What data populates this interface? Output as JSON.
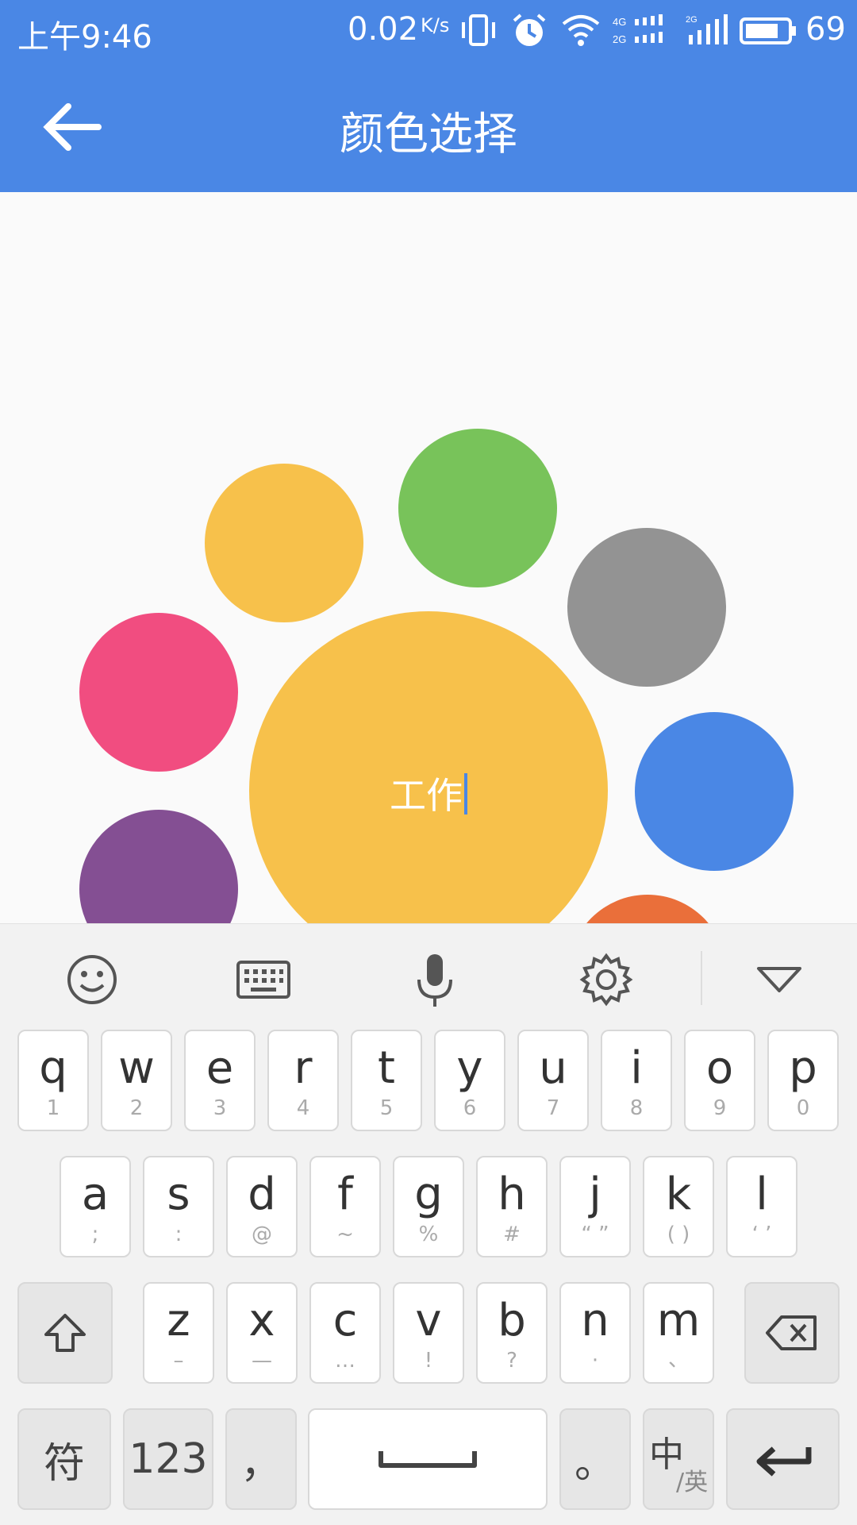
{
  "status_bar": {
    "time": "上午9:46",
    "net_speed": "0.02",
    "net_speed_unit": "K/s",
    "battery_percent": "69",
    "icons": [
      "vibrate-icon",
      "alarm-icon",
      "wifi-icon",
      "4g-signal-icon",
      "2g-signal-icon",
      "battery-icon"
    ]
  },
  "app_bar": {
    "title": "颜色选择",
    "back_icon": "arrow-left-icon"
  },
  "colors": {
    "accent": "#4a87e5",
    "selected": "#f7c14b"
  },
  "bubbles": [
    {
      "name": "color-bubble-yellow",
      "color": "#f7c14b"
    },
    {
      "name": "color-bubble-green",
      "color": "#78c35a"
    },
    {
      "name": "color-bubble-gray",
      "color": "#939393"
    },
    {
      "name": "color-bubble-pink",
      "color": "#f14d80"
    },
    {
      "name": "color-bubble-blue",
      "color": "#4a87e5"
    },
    {
      "name": "color-bubble-purple",
      "color": "#844f93"
    },
    {
      "name": "color-bubble-orange",
      "color": "#ea6f3a"
    }
  ],
  "selected_bubble": {
    "label": "工作",
    "color": "#f7c14b"
  },
  "keyboard": {
    "toolbar_icons": [
      "emoji-icon",
      "keyboard-icon",
      "microphone-icon",
      "settings-icon",
      "collapse-icon"
    ],
    "row1": [
      {
        "k": "q",
        "s": "1"
      },
      {
        "k": "w",
        "s": "2"
      },
      {
        "k": "e",
        "s": "3"
      },
      {
        "k": "r",
        "s": "4"
      },
      {
        "k": "t",
        "s": "5"
      },
      {
        "k": "y",
        "s": "6"
      },
      {
        "k": "u",
        "s": "7"
      },
      {
        "k": "i",
        "s": "8"
      },
      {
        "k": "o",
        "s": "9"
      },
      {
        "k": "p",
        "s": "0"
      }
    ],
    "row2": [
      {
        "k": "a",
        "s": ";"
      },
      {
        "k": "s",
        "s": ":"
      },
      {
        "k": "d",
        "s": "@"
      },
      {
        "k": "f",
        "s": "~"
      },
      {
        "k": "g",
        "s": "%"
      },
      {
        "k": "h",
        "s": "#"
      },
      {
        "k": "j",
        "s": "“ ”"
      },
      {
        "k": "k",
        "s": "( )"
      },
      {
        "k": "l",
        "s": "‘ ’"
      }
    ],
    "row3": [
      {
        "k": "z",
        "s": "–"
      },
      {
        "k": "x",
        "s": "—"
      },
      {
        "k": "c",
        "s": "…"
      },
      {
        "k": "v",
        "s": "!"
      },
      {
        "k": "b",
        "s": "?"
      },
      {
        "k": "n",
        "s": "·"
      },
      {
        "k": "m",
        "s": "、"
      }
    ],
    "bottom": {
      "symbols": "符",
      "numbers": "123",
      "comma": "，",
      "period": "。",
      "lang_main": "中",
      "lang_sub": "/英"
    }
  }
}
